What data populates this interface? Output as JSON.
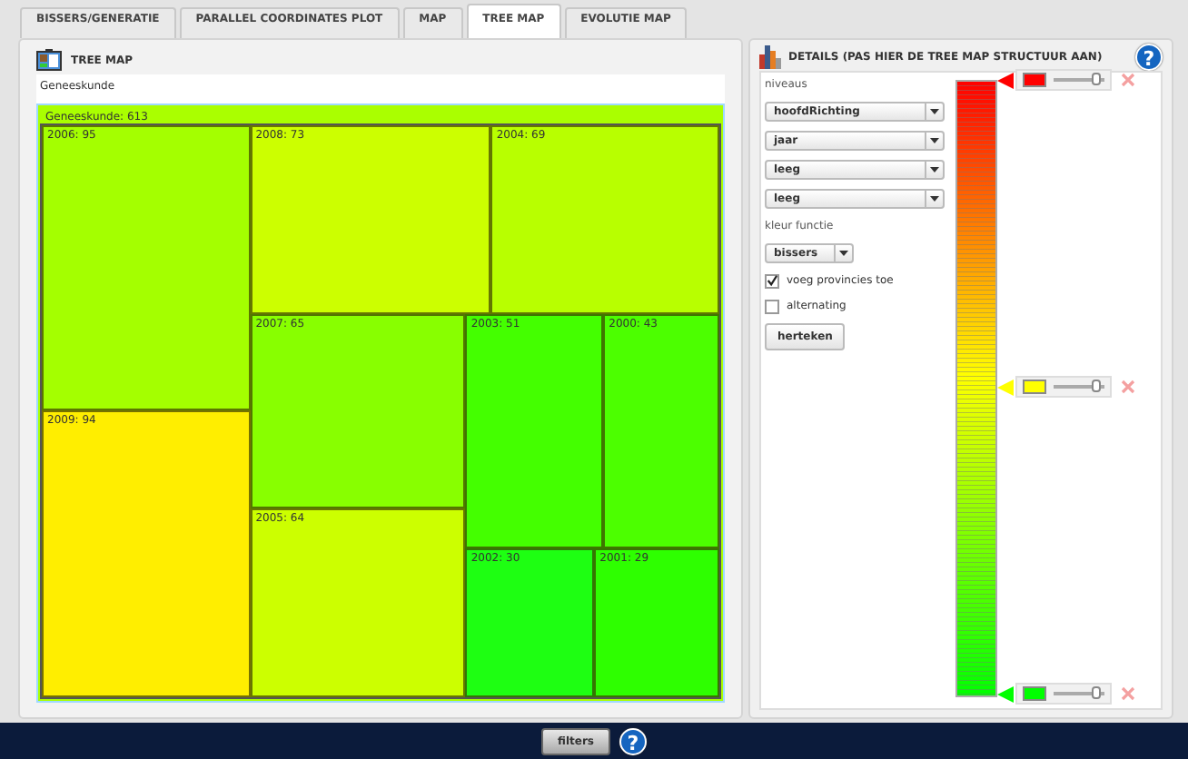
{
  "tabs": [
    {
      "label": "BISSERS/GENERATIE",
      "selected": false
    },
    {
      "label": "PARALLEL COORDINATES PLOT",
      "selected": false
    },
    {
      "label": "MAP",
      "selected": false
    },
    {
      "label": "TREE MAP",
      "selected": true
    },
    {
      "label": "EVOLUTIE MAP",
      "selected": false
    }
  ],
  "treemap_panel": {
    "title": "TREE MAP",
    "breadcrumb": "Geneeskunde",
    "root": {
      "label": "Geneeskunde: 613",
      "color": "#aaff00"
    },
    "cells": [
      {
        "label": "2006: 95",
        "color": "#a4ff00"
      },
      {
        "label": "2008: 73",
        "color": "#ccff00"
      },
      {
        "label": "2004: 69",
        "color": "#b8ff00"
      },
      {
        "label": "2007: 65",
        "color": "#88ff00"
      },
      {
        "label": "2003: 51",
        "color": "#44ff00"
      },
      {
        "label": "2000: 43",
        "color": "#4cff00"
      },
      {
        "label": "2009: 94",
        "color": "#ffee00"
      },
      {
        "label": "2005: 64",
        "color": "#ccff00"
      },
      {
        "label": "2002: 30",
        "color": "#1eff12"
      },
      {
        "label": "2001: 29",
        "color": "#2eff00"
      }
    ]
  },
  "details_panel": {
    "title": "DETAILS (PAS HIER DE TREE MAP STRUCTUUR AAN)",
    "help": "?",
    "levels_label": "niveaus",
    "levels": [
      "hoofdRichting",
      "jaar",
      "leeg",
      "leeg"
    ],
    "color_function_label": "kleur functie",
    "color_function": "bissers",
    "checkboxes": [
      {
        "label": "voeg provincies toe",
        "checked": true
      },
      {
        "label": "alternating",
        "checked": false
      }
    ],
    "redraw_button": "herteken",
    "color_stops": [
      {
        "color": "#ff0000",
        "level": 0.85
      },
      {
        "color": "#ffff00",
        "level": 0.85
      },
      {
        "color": "#00ff00",
        "level": 0.85
      }
    ]
  },
  "footer": {
    "filters_button": "filters",
    "help": "?"
  }
}
